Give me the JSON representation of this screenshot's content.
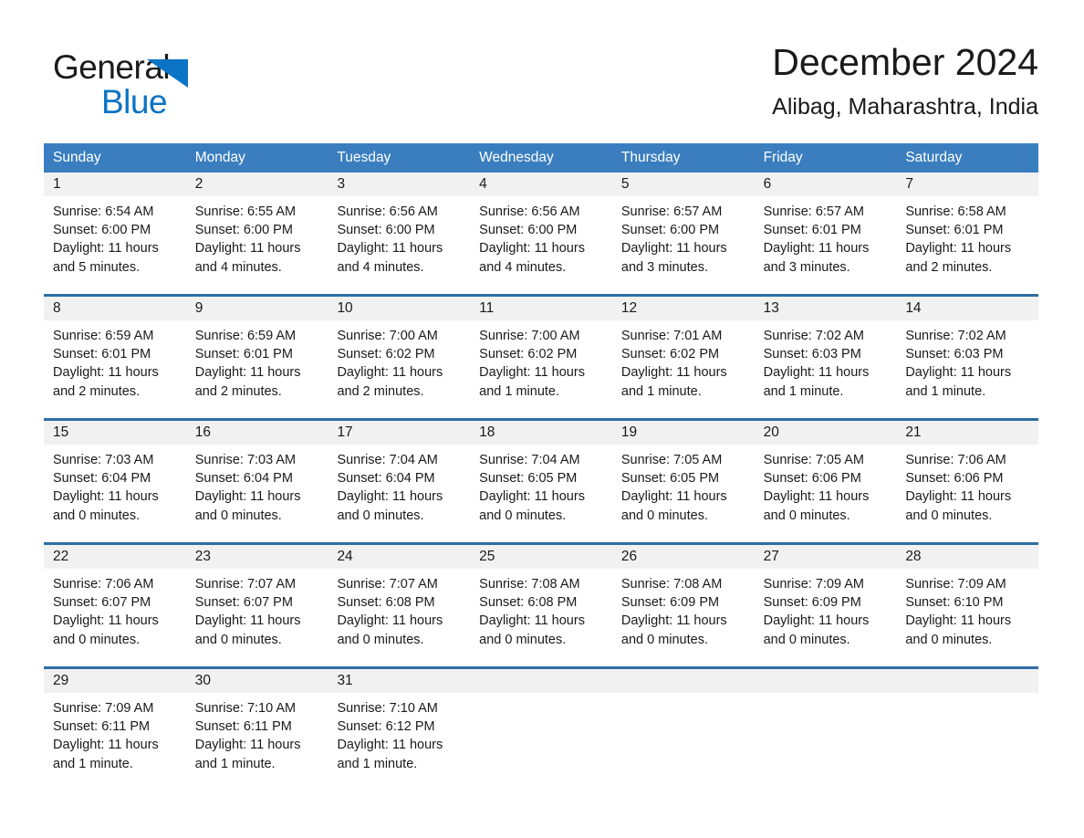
{
  "brand": {
    "name_part1": "General",
    "name_part2": "Blue",
    "logo_icon": "triangle-logo-icon",
    "accent_color": "#0b74c4"
  },
  "header": {
    "title": "December 2024",
    "location": "Alibag, Maharashtra, India"
  },
  "theme": {
    "header_blue": "#3a7ebf",
    "row_divider_blue": "#2e6da4",
    "day_band_gray": "#f1f1f1"
  },
  "calendar": {
    "weekdays": [
      "Sunday",
      "Monday",
      "Tuesday",
      "Wednesday",
      "Thursday",
      "Friday",
      "Saturday"
    ],
    "weeks": [
      [
        {
          "day": "1",
          "sunrise": "Sunrise: 6:54 AM",
          "sunset": "Sunset: 6:00 PM",
          "daylight": "Daylight: 11 hours and 5 minutes."
        },
        {
          "day": "2",
          "sunrise": "Sunrise: 6:55 AM",
          "sunset": "Sunset: 6:00 PM",
          "daylight": "Daylight: 11 hours and 4 minutes."
        },
        {
          "day": "3",
          "sunrise": "Sunrise: 6:56 AM",
          "sunset": "Sunset: 6:00 PM",
          "daylight": "Daylight: 11 hours and 4 minutes."
        },
        {
          "day": "4",
          "sunrise": "Sunrise: 6:56 AM",
          "sunset": "Sunset: 6:00 PM",
          "daylight": "Daylight: 11 hours and 4 minutes."
        },
        {
          "day": "5",
          "sunrise": "Sunrise: 6:57 AM",
          "sunset": "Sunset: 6:00 PM",
          "daylight": "Daylight: 11 hours and 3 minutes."
        },
        {
          "day": "6",
          "sunrise": "Sunrise: 6:57 AM",
          "sunset": "Sunset: 6:01 PM",
          "daylight": "Daylight: 11 hours and 3 minutes."
        },
        {
          "day": "7",
          "sunrise": "Sunrise: 6:58 AM",
          "sunset": "Sunset: 6:01 PM",
          "daylight": "Daylight: 11 hours and 2 minutes."
        }
      ],
      [
        {
          "day": "8",
          "sunrise": "Sunrise: 6:59 AM",
          "sunset": "Sunset: 6:01 PM",
          "daylight": "Daylight: 11 hours and 2 minutes."
        },
        {
          "day": "9",
          "sunrise": "Sunrise: 6:59 AM",
          "sunset": "Sunset: 6:01 PM",
          "daylight": "Daylight: 11 hours and 2 minutes."
        },
        {
          "day": "10",
          "sunrise": "Sunrise: 7:00 AM",
          "sunset": "Sunset: 6:02 PM",
          "daylight": "Daylight: 11 hours and 2 minutes."
        },
        {
          "day": "11",
          "sunrise": "Sunrise: 7:00 AM",
          "sunset": "Sunset: 6:02 PM",
          "daylight": "Daylight: 11 hours and 1 minute."
        },
        {
          "day": "12",
          "sunrise": "Sunrise: 7:01 AM",
          "sunset": "Sunset: 6:02 PM",
          "daylight": "Daylight: 11 hours and 1 minute."
        },
        {
          "day": "13",
          "sunrise": "Sunrise: 7:02 AM",
          "sunset": "Sunset: 6:03 PM",
          "daylight": "Daylight: 11 hours and 1 minute."
        },
        {
          "day": "14",
          "sunrise": "Sunrise: 7:02 AM",
          "sunset": "Sunset: 6:03 PM",
          "daylight": "Daylight: 11 hours and 1 minute."
        }
      ],
      [
        {
          "day": "15",
          "sunrise": "Sunrise: 7:03 AM",
          "sunset": "Sunset: 6:04 PM",
          "daylight": "Daylight: 11 hours and 0 minutes."
        },
        {
          "day": "16",
          "sunrise": "Sunrise: 7:03 AM",
          "sunset": "Sunset: 6:04 PM",
          "daylight": "Daylight: 11 hours and 0 minutes."
        },
        {
          "day": "17",
          "sunrise": "Sunrise: 7:04 AM",
          "sunset": "Sunset: 6:04 PM",
          "daylight": "Daylight: 11 hours and 0 minutes."
        },
        {
          "day": "18",
          "sunrise": "Sunrise: 7:04 AM",
          "sunset": "Sunset: 6:05 PM",
          "daylight": "Daylight: 11 hours and 0 minutes."
        },
        {
          "day": "19",
          "sunrise": "Sunrise: 7:05 AM",
          "sunset": "Sunset: 6:05 PM",
          "daylight": "Daylight: 11 hours and 0 minutes."
        },
        {
          "day": "20",
          "sunrise": "Sunrise: 7:05 AM",
          "sunset": "Sunset: 6:06 PM",
          "daylight": "Daylight: 11 hours and 0 minutes."
        },
        {
          "day": "21",
          "sunrise": "Sunrise: 7:06 AM",
          "sunset": "Sunset: 6:06 PM",
          "daylight": "Daylight: 11 hours and 0 minutes."
        }
      ],
      [
        {
          "day": "22",
          "sunrise": "Sunrise: 7:06 AM",
          "sunset": "Sunset: 6:07 PM",
          "daylight": "Daylight: 11 hours and 0 minutes."
        },
        {
          "day": "23",
          "sunrise": "Sunrise: 7:07 AM",
          "sunset": "Sunset: 6:07 PM",
          "daylight": "Daylight: 11 hours and 0 minutes."
        },
        {
          "day": "24",
          "sunrise": "Sunrise: 7:07 AM",
          "sunset": "Sunset: 6:08 PM",
          "daylight": "Daylight: 11 hours and 0 minutes."
        },
        {
          "day": "25",
          "sunrise": "Sunrise: 7:08 AM",
          "sunset": "Sunset: 6:08 PM",
          "daylight": "Daylight: 11 hours and 0 minutes."
        },
        {
          "day": "26",
          "sunrise": "Sunrise: 7:08 AM",
          "sunset": "Sunset: 6:09 PM",
          "daylight": "Daylight: 11 hours and 0 minutes."
        },
        {
          "day": "27",
          "sunrise": "Sunrise: 7:09 AM",
          "sunset": "Sunset: 6:09 PM",
          "daylight": "Daylight: 11 hours and 0 minutes."
        },
        {
          "day": "28",
          "sunrise": "Sunrise: 7:09 AM",
          "sunset": "Sunset: 6:10 PM",
          "daylight": "Daylight: 11 hours and 0 minutes."
        }
      ],
      [
        {
          "day": "29",
          "sunrise": "Sunrise: 7:09 AM",
          "sunset": "Sunset: 6:11 PM",
          "daylight": "Daylight: 11 hours and 1 minute."
        },
        {
          "day": "30",
          "sunrise": "Sunrise: 7:10 AM",
          "sunset": "Sunset: 6:11 PM",
          "daylight": "Daylight: 11 hours and 1 minute."
        },
        {
          "day": "31",
          "sunrise": "Sunrise: 7:10 AM",
          "sunset": "Sunset: 6:12 PM",
          "daylight": "Daylight: 11 hours and 1 minute."
        },
        {
          "day": "",
          "sunrise": "",
          "sunset": "",
          "daylight": ""
        },
        {
          "day": "",
          "sunrise": "",
          "sunset": "",
          "daylight": ""
        },
        {
          "day": "",
          "sunrise": "",
          "sunset": "",
          "daylight": ""
        },
        {
          "day": "",
          "sunrise": "",
          "sunset": "",
          "daylight": ""
        }
      ]
    ]
  }
}
